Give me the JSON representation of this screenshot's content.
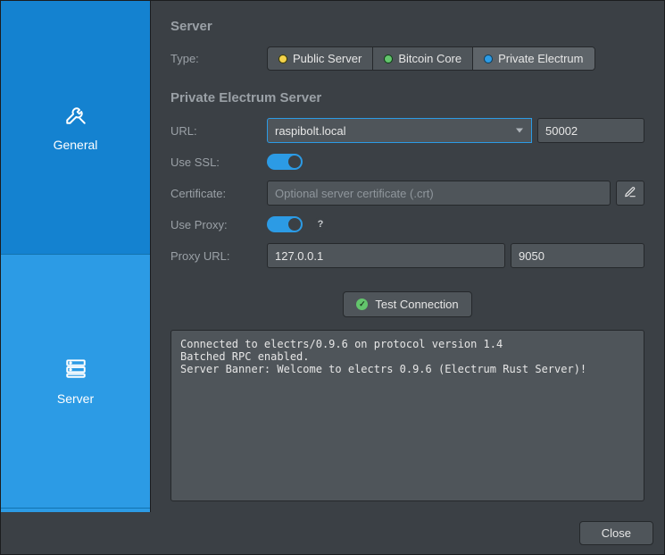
{
  "sidebar": {
    "items": [
      {
        "label": "General",
        "icon": "tools-icon"
      },
      {
        "label": "Server",
        "icon": "server-icon"
      }
    ],
    "active_index": 1
  },
  "server": {
    "heading": "Server",
    "type_label": "Type:",
    "type_options": [
      {
        "label": "Public Server",
        "dot": "yellow"
      },
      {
        "label": "Bitcoin Core",
        "dot": "green"
      },
      {
        "label": "Private Electrum",
        "dot": "blue"
      }
    ],
    "type_selected_index": 2
  },
  "private_electrum": {
    "heading": "Private Electrum Server",
    "url_label": "URL:",
    "url_host": "raspibolt.local",
    "url_port": "50002",
    "use_ssl_label": "Use SSL:",
    "use_ssl": true,
    "certificate_label": "Certificate:",
    "certificate_placeholder": "Optional server certificate (.crt)",
    "certificate_value": "",
    "use_proxy_label": "Use Proxy:",
    "use_proxy": true,
    "proxy_url_label": "Proxy URL:",
    "proxy_host": "127.0.0.1",
    "proxy_port": "9050",
    "test_button_label": "Test Connection"
  },
  "log_text": "Connected to electrs/0.9.6 on protocol version 1.4\nBatched RPC enabled.\nServer Banner: Welcome to electrs 0.9.6 (Electrum Rust Server)!",
  "footer": {
    "close_label": "Close"
  }
}
